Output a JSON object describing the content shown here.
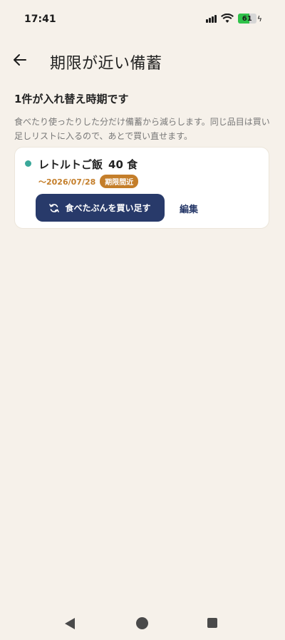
{
  "status_bar": {
    "time": "17:41",
    "battery_level": "61",
    "icons": [
      "signal-icon",
      "wifi-icon",
      "battery-icon",
      "charging-icon"
    ]
  },
  "app_bar": {
    "back_icon": "arrow-left-icon",
    "title": "期限が近い備蓄"
  },
  "summary": {
    "heading": "1件が入れ替え時期です",
    "description": "食べたり使ったりした分だけ備蓄から減らします。同じ品目は買い足しリストに入るので、あとで買い直せます。"
  },
  "items": [
    {
      "name": "レトルトご飯",
      "quantity": "40 食",
      "expiry": "〜2026/07/28",
      "status_badge": "期限間近",
      "status_color": "#c47e2a",
      "dot_color": "#3aa89a",
      "restock_label": "食べたぶんを買い足す",
      "restock_icon": "refresh-icon",
      "edit_label": "編集"
    }
  ],
  "colors": {
    "background": "#f6f1ea",
    "primary": "#283a6a",
    "accent": "#c47e2a",
    "battery_fill": "#2fc24a"
  }
}
